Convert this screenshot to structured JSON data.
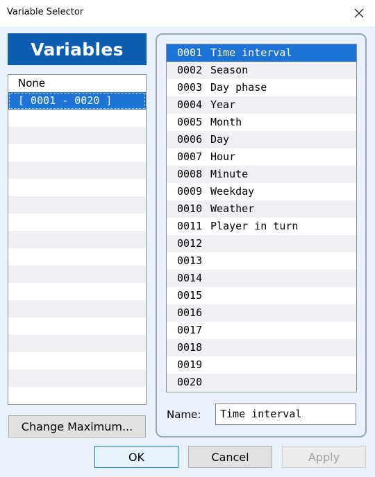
{
  "window": {
    "title": "Variable Selector"
  },
  "header": {
    "label": "Variables"
  },
  "groups": {
    "items": [
      "None",
      "[ 0001 - 0020 ]",
      "",
      "",
      "",
      "",
      "",
      "",
      "",
      "",
      "",
      "",
      "",
      "",
      "",
      "",
      "",
      "",
      ""
    ],
    "selected_index": 1
  },
  "variables": {
    "selected_index": 0,
    "items": [
      {
        "id": "0001",
        "name": "Time interval"
      },
      {
        "id": "0002",
        "name": "Season"
      },
      {
        "id": "0003",
        "name": "Day phase"
      },
      {
        "id": "0004",
        "name": "Year"
      },
      {
        "id": "0005",
        "name": "Month"
      },
      {
        "id": "0006",
        "name": "Day"
      },
      {
        "id": "0007",
        "name": "Hour"
      },
      {
        "id": "0008",
        "name": "Minute"
      },
      {
        "id": "0009",
        "name": "Weekday"
      },
      {
        "id": "0010",
        "name": "Weather"
      },
      {
        "id": "0011",
        "name": "Player in turn"
      },
      {
        "id": "0012",
        "name": ""
      },
      {
        "id": "0013",
        "name": ""
      },
      {
        "id": "0014",
        "name": ""
      },
      {
        "id": "0015",
        "name": ""
      },
      {
        "id": "0016",
        "name": ""
      },
      {
        "id": "0017",
        "name": ""
      },
      {
        "id": "0018",
        "name": ""
      },
      {
        "id": "0019",
        "name": ""
      },
      {
        "id": "0020",
        "name": ""
      }
    ]
  },
  "name_field": {
    "label": "Name:",
    "value": "Time interval"
  },
  "buttons": {
    "change_maximum": "Change Maximum...",
    "ok": "OK",
    "cancel": "Cancel",
    "apply": "Apply"
  },
  "icons": {
    "close": "close-icon"
  },
  "colors": {
    "accent": "#0d5db3",
    "selection": "#1e73d6"
  }
}
